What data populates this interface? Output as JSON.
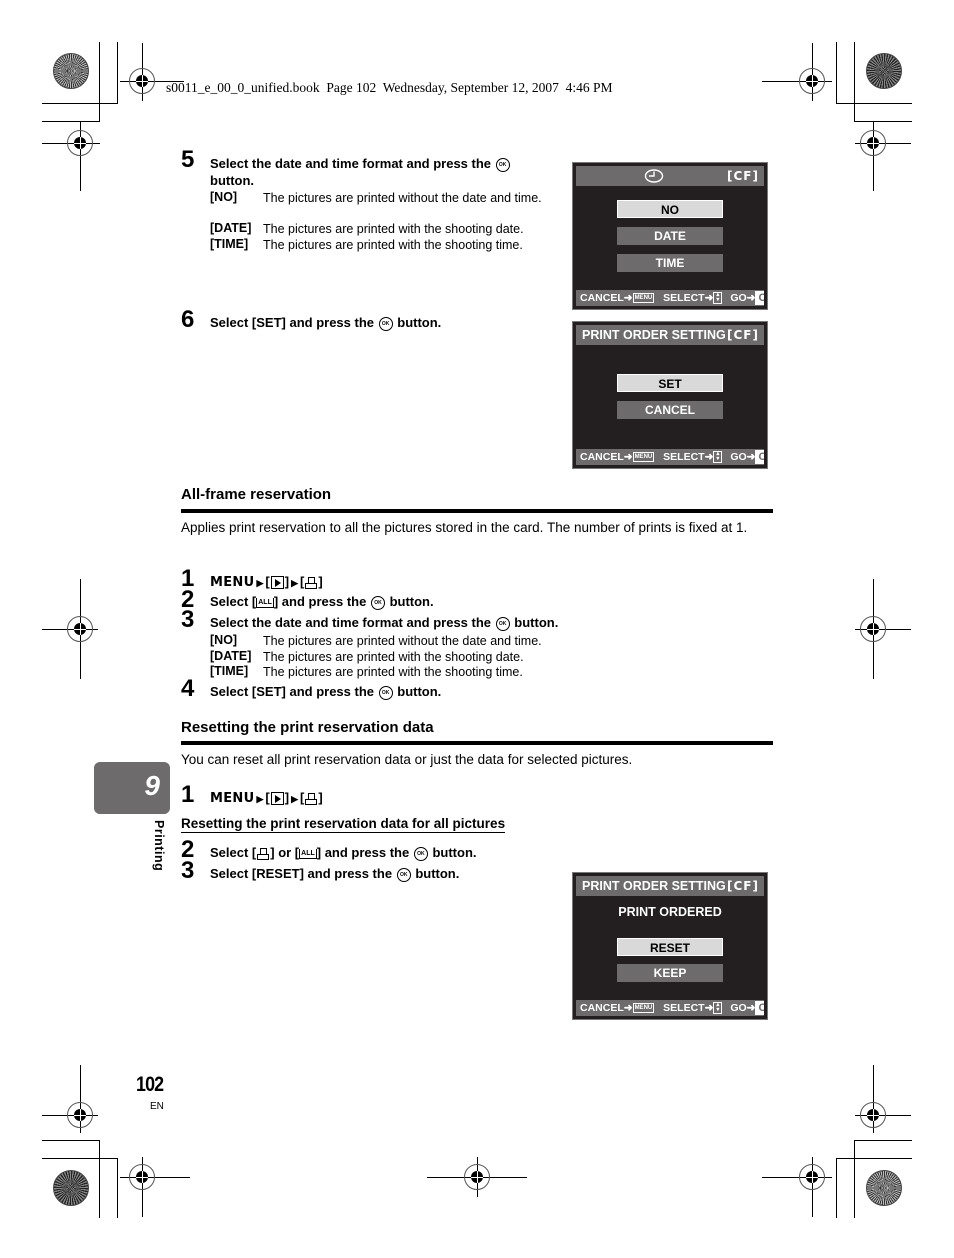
{
  "header": {
    "file_info": "s0011_e_00_0_unified.book  Page 102  Wednesday, September 12, 2007  4:46 PM"
  },
  "steps_top": [
    {
      "number": "5",
      "text_before_icon": "Select the date and time format and press the",
      "text_after_icon": "button.",
      "definitions": [
        {
          "key": "[NO]",
          "value": "The pictures are printed without the date and time."
        },
        {
          "key": "[DATE]",
          "value": "The pictures are printed with the shooting date."
        },
        {
          "key": "[TIME]",
          "value": "The pictures are printed with the shooting time."
        }
      ]
    },
    {
      "number": "6",
      "text_before_icon": "Select [SET] and press the",
      "text_after_icon": "button."
    }
  ],
  "ok_icon_label": "OK",
  "screens": {
    "date_format": {
      "icon": "clock-icon",
      "card": "[CF]",
      "options": [
        "NO",
        "DATE",
        "TIME"
      ],
      "selected": "NO"
    },
    "print_order_set": {
      "title": "PRINT ORDER SETTING",
      "card": "[CF]",
      "options": [
        "SET",
        "CANCEL"
      ],
      "selected": "SET"
    },
    "print_order_reset": {
      "title": "PRINT ORDER SETTING",
      "card": "[CF]",
      "message": "PRINT ORDERED",
      "options": [
        "RESET",
        "KEEP"
      ],
      "selected": "RESET"
    },
    "footer": {
      "cancel": "CANCEL",
      "menu": "MENU",
      "select": "SELECT",
      "go": "GO",
      "ok": "OK"
    }
  },
  "all_frame": {
    "title": "All-frame reservation",
    "description": "Applies print reservation to all the pictures stored in the card. The number of prints is fixed at 1.",
    "steps": [
      {
        "number": "1",
        "menu": "MENU",
        "open": "[",
        "close": "]"
      },
      {
        "number": "2",
        "before": "Select [",
        "after": "] and press the",
        "end": "button.",
        "all_label": "ALL"
      },
      {
        "number": "3",
        "before": "Select the date and time format and press the",
        "end": "button."
      },
      {
        "number": "4",
        "before": "Select [SET] and press the",
        "end": "button."
      }
    ],
    "definitions": [
      {
        "key": "[NO]",
        "value": "The pictures are printed without the date and time."
      },
      {
        "key": "[DATE]",
        "value": "The pictures are printed with the shooting date."
      },
      {
        "key": "[TIME]",
        "value": "The pictures are printed with the shooting time."
      }
    ]
  },
  "reset": {
    "title": "Resetting the print reservation data",
    "description": "You can reset all print reservation data or just the data for selected pictures.",
    "step1": {
      "number": "1",
      "menu": "MENU"
    },
    "subheading": "Resetting the print reservation data for all pictures",
    "step2": {
      "number": "2",
      "before": "Select [",
      "mid": "] or [",
      "after": "] and press the",
      "end": "button.",
      "all_label": "ALL"
    },
    "step3": {
      "number": "3",
      "before": "Select [RESET] and press the",
      "end": "button."
    }
  },
  "chapter": {
    "number": "9",
    "label": "Printing"
  },
  "footer": {
    "page_number": "102",
    "language": "EN"
  }
}
